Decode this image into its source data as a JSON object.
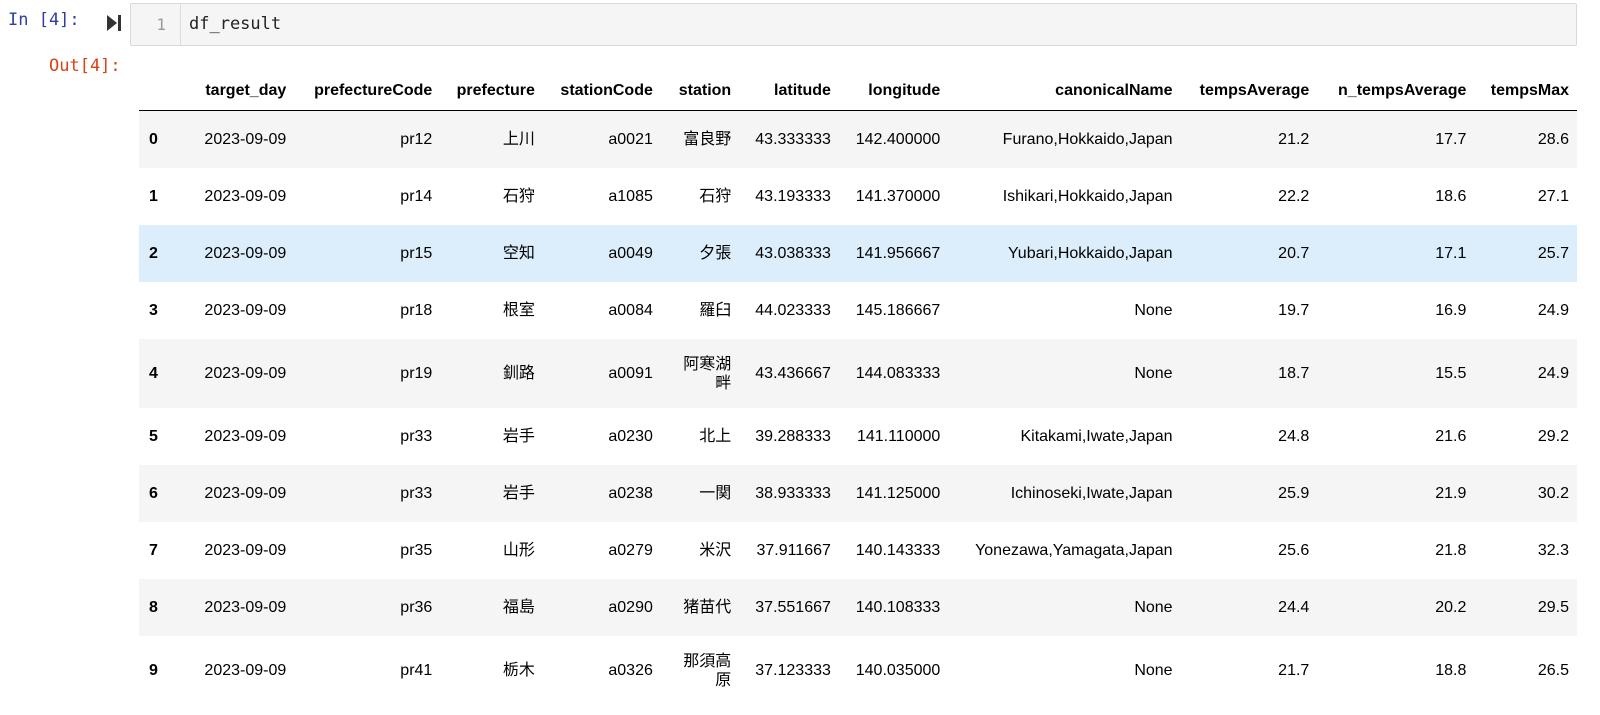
{
  "input_cell": {
    "prompt": "In [4]:",
    "line_number": "1",
    "code": "df_result"
  },
  "output_cell": {
    "prompt": "Out[4]:"
  },
  "table": {
    "columns": [
      "",
      "target_day",
      "prefectureCode",
      "prefecture",
      "stationCode",
      "station",
      "latitude",
      "longitude",
      "canonicalName",
      "tempsAverage",
      "n_tempsAverage",
      "tempsMax"
    ],
    "rows": [
      {
        "index": "0",
        "target_day": "2023-09-09",
        "prefectureCode": "pr12",
        "prefecture": "上川",
        "stationCode": "a0021",
        "station": "富良野",
        "latitude": "43.333333",
        "longitude": "142.400000",
        "canonicalName": "Furano,Hokkaido,Japan",
        "tempsAverage": "21.2",
        "n_tempsAverage": "17.7",
        "tempsMax": "28.6"
      },
      {
        "index": "1",
        "target_day": "2023-09-09",
        "prefectureCode": "pr14",
        "prefecture": "石狩",
        "stationCode": "a1085",
        "station": "石狩",
        "latitude": "43.193333",
        "longitude": "141.370000",
        "canonicalName": "Ishikari,Hokkaido,Japan",
        "tempsAverage": "22.2",
        "n_tempsAverage": "18.6",
        "tempsMax": "27.1"
      },
      {
        "index": "2",
        "target_day": "2023-09-09",
        "prefectureCode": "pr15",
        "prefecture": "空知",
        "stationCode": "a0049",
        "station": "夕張",
        "latitude": "43.038333",
        "longitude": "141.956667",
        "canonicalName": "Yubari,Hokkaido,Japan",
        "tempsAverage": "20.7",
        "n_tempsAverage": "17.1",
        "tempsMax": "25.7"
      },
      {
        "index": "3",
        "target_day": "2023-09-09",
        "prefectureCode": "pr18",
        "prefecture": "根室",
        "stationCode": "a0084",
        "station": "羅臼",
        "latitude": "44.023333",
        "longitude": "145.186667",
        "canonicalName": "None",
        "tempsAverage": "19.7",
        "n_tempsAverage": "16.9",
        "tempsMax": "24.9"
      },
      {
        "index": "4",
        "target_day": "2023-09-09",
        "prefectureCode": "pr19",
        "prefecture": "釧路",
        "stationCode": "a0091",
        "station": "阿寒湖畔",
        "latitude": "43.436667",
        "longitude": "144.083333",
        "canonicalName": "None",
        "tempsAverage": "18.7",
        "n_tempsAverage": "15.5",
        "tempsMax": "24.9"
      },
      {
        "index": "5",
        "target_day": "2023-09-09",
        "prefectureCode": "pr33",
        "prefecture": "岩手",
        "stationCode": "a0230",
        "station": "北上",
        "latitude": "39.288333",
        "longitude": "141.110000",
        "canonicalName": "Kitakami,Iwate,Japan",
        "tempsAverage": "24.8",
        "n_tempsAverage": "21.6",
        "tempsMax": "29.2"
      },
      {
        "index": "6",
        "target_day": "2023-09-09",
        "prefectureCode": "pr33",
        "prefecture": "岩手",
        "stationCode": "a0238",
        "station": "一関",
        "latitude": "38.933333",
        "longitude": "141.125000",
        "canonicalName": "Ichinoseki,Iwate,Japan",
        "tempsAverage": "25.9",
        "n_tempsAverage": "21.9",
        "tempsMax": "30.2"
      },
      {
        "index": "7",
        "target_day": "2023-09-09",
        "prefectureCode": "pr35",
        "prefecture": "山形",
        "stationCode": "a0279",
        "station": "米沢",
        "latitude": "37.911667",
        "longitude": "140.143333",
        "canonicalName": "Yonezawa,Yamagata,Japan",
        "tempsAverage": "25.6",
        "n_tempsAverage": "21.8",
        "tempsMax": "32.3"
      },
      {
        "index": "8",
        "target_day": "2023-09-09",
        "prefectureCode": "pr36",
        "prefecture": "福島",
        "stationCode": "a0290",
        "station": "猪苗代",
        "latitude": "37.551667",
        "longitude": "140.108333",
        "canonicalName": "None",
        "tempsAverage": "24.4",
        "n_tempsAverage": "20.2",
        "tempsMax": "29.5"
      },
      {
        "index": "9",
        "target_day": "2023-09-09",
        "prefectureCode": "pr41",
        "prefecture": "栃木",
        "stationCode": "a0326",
        "station": "那須高原",
        "latitude": "37.123333",
        "longitude": "140.035000",
        "canonicalName": "None",
        "tempsAverage": "21.7",
        "n_tempsAverage": "18.8",
        "tempsMax": "26.5"
      }
    ],
    "selected_row": 2,
    "colors": {
      "stripe": "#f5f5f5",
      "selected": "#dceefc",
      "in_prompt": "#303f9f",
      "out_prompt": "#d84315"
    }
  },
  "icons": {
    "run": "run-cell-icon"
  }
}
